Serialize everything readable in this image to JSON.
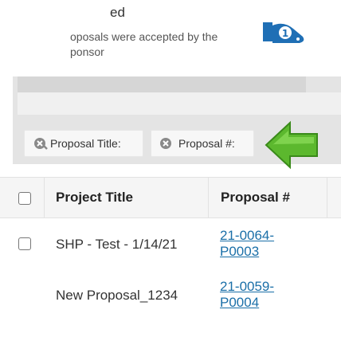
{
  "summary": {
    "title_fragment": "ed",
    "text_line1": "oposals were accepted by the",
    "text_line2": "ponsor",
    "icon": "accepted-hand-icon",
    "icon_badge": "1"
  },
  "filters": {
    "chips": [
      {
        "label": "Proposal Title:",
        "icon": "remove-filter-icon"
      },
      {
        "label": "Proposal #:",
        "icon": "remove-filter-icon"
      }
    ],
    "pointer_icon": "green-arrow-pointer-icon",
    "pointer_color": "#5cb82e"
  },
  "table": {
    "columns": [
      "Project Title",
      "Proposal #"
    ],
    "rows": [
      {
        "title": "SHP - Test - 1/14/21",
        "proposal_line1": "21-0064-",
        "proposal_line2": "P0003"
      },
      {
        "title": "New Proposal_1234",
        "proposal_line1": "21-0059-",
        "proposal_line2": "P0004"
      }
    ]
  },
  "colors": {
    "link": "#1a6fa8",
    "icon_blue": "#1f6fb5",
    "header_bg": "#f5f5f5"
  }
}
